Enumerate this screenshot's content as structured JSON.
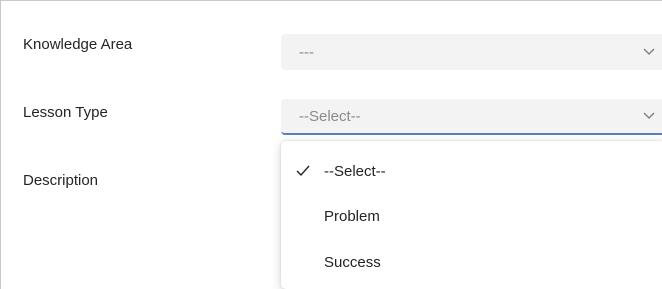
{
  "form": {
    "knowledge_area_label": "Knowledge Area",
    "knowledge_area_value": "---",
    "lesson_type_label": "Lesson Type",
    "lesson_type_value": "--Select--",
    "description_label": "Description"
  },
  "dropdown": {
    "options": [
      {
        "label": "--Select--",
        "selected": true
      },
      {
        "label": "Problem",
        "selected": false
      },
      {
        "label": "Success",
        "selected": false
      }
    ]
  },
  "colors": {
    "field_bg": "#f3f3f3",
    "focus_underline": "#5b7fb6",
    "placeholder_text": "#8a8a8a"
  },
  "icons": {
    "select_arrow": "chevron-down-icon",
    "selected_mark": "checkmark-icon"
  }
}
